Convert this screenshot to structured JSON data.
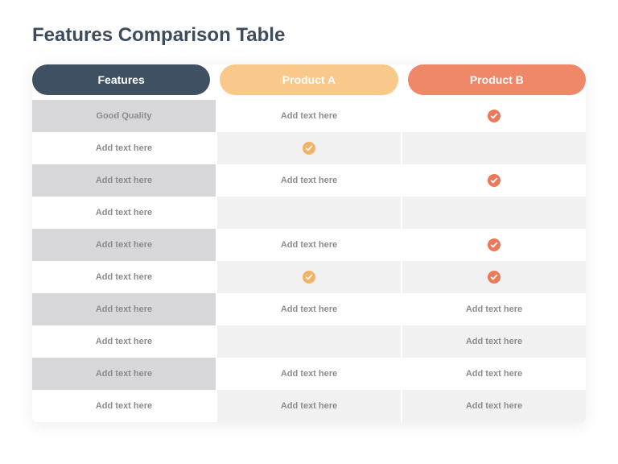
{
  "title": "Features Comparison Table",
  "headers": [
    "Features",
    "Product A",
    "Product B"
  ],
  "placeholder": "Add text here",
  "rows": [
    {
      "feature": "Good Quality",
      "a": "text",
      "b": "check"
    },
    {
      "feature": "Add text here",
      "a": "check",
      "b": ""
    },
    {
      "feature": "Add text here",
      "a": "text",
      "b": "check"
    },
    {
      "feature": "Add text here",
      "a": "",
      "b": ""
    },
    {
      "feature": "Add text here",
      "a": "text",
      "b": "check"
    },
    {
      "feature": "Add text here",
      "a": "check",
      "b": "check"
    },
    {
      "feature": "Add text here",
      "a": "text",
      "b": "text"
    },
    {
      "feature": "Add text here",
      "a": "",
      "b": "text"
    },
    {
      "feature": "Add text here",
      "a": "text",
      "b": "text"
    },
    {
      "feature": "Add text here",
      "a": "text",
      "b": "text"
    }
  ],
  "colors": {
    "features_pill": "#3f5063",
    "product_a_pill": "#f8c98a",
    "product_b_pill": "#ef8769",
    "check_a": "#f2b267",
    "check_b": "#ea7a5a"
  }
}
